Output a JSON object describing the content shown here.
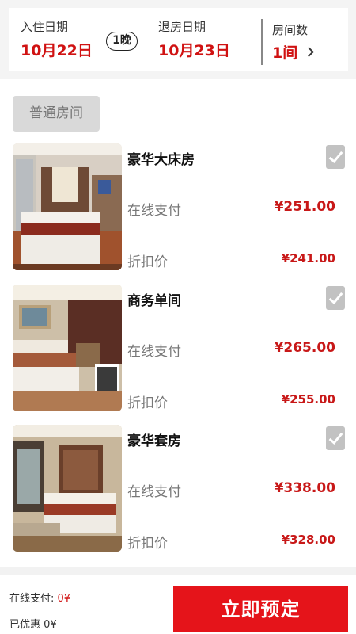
{
  "header": {
    "checkin_label": "入住日期",
    "checkin_date": "10月22日",
    "nights": "1晚",
    "checkout_label": "退房日期",
    "checkout_date": "10月23日",
    "rooms_label": "房间数",
    "rooms_value": "1间"
  },
  "room_type_tab": "普通房间",
  "rooms": [
    {
      "name": "豪华大床房",
      "pay_label": "在线支付",
      "pay_price": "¥251.00",
      "discount_label": "折扣价",
      "discount_price": "¥241.00"
    },
    {
      "name": "商务单间",
      "pay_label": "在线支付",
      "pay_price": "¥265.00",
      "discount_label": "折扣价",
      "discount_price": "¥255.00"
    },
    {
      "name": "豪华套房",
      "pay_label": "在线支付",
      "pay_price": "¥338.00",
      "discount_label": "折扣价",
      "discount_price": "¥328.00"
    }
  ],
  "footer": {
    "online_pay_label": "在线支付:",
    "online_pay_value": "0¥",
    "saved_label": "已优惠",
    "saved_value": "0¥",
    "book_button": "立即预定"
  },
  "colors": {
    "accent": "#e5141a",
    "price": "#c81818"
  }
}
